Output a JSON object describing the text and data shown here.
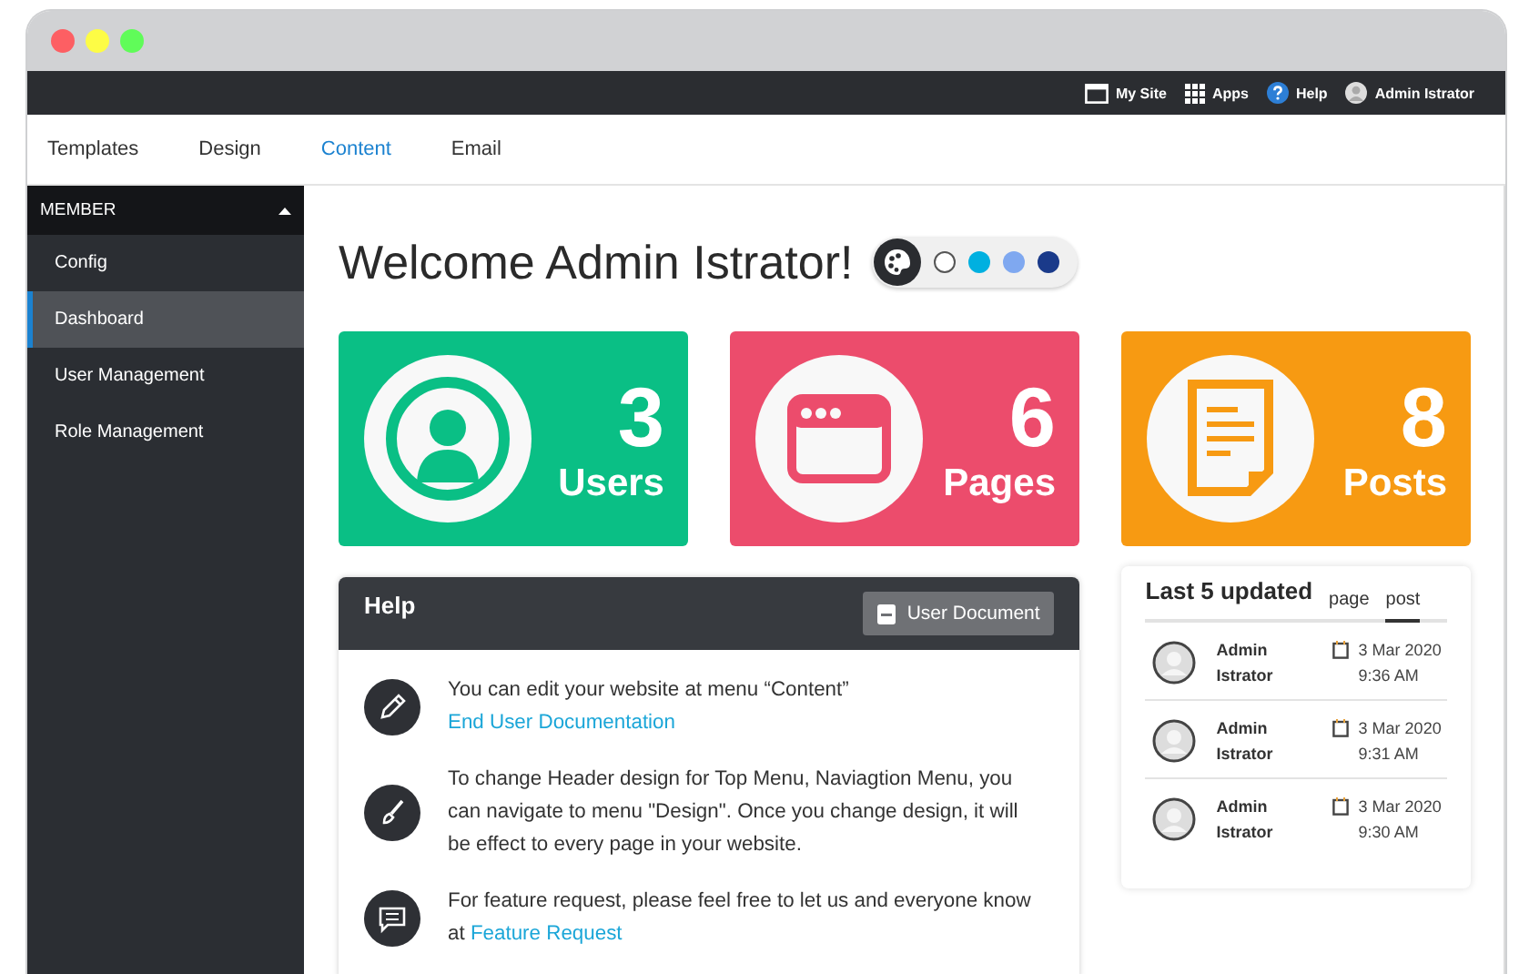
{
  "topbar": {
    "links": [
      {
        "label": "My Site",
        "kind": "site"
      },
      {
        "label": "Apps",
        "kind": "apps"
      },
      {
        "label": "Help",
        "kind": "help"
      },
      {
        "label": "Admin Istrator",
        "kind": "user"
      }
    ]
  },
  "tabs": [
    {
      "label": "Templates",
      "selected": false
    },
    {
      "label": "Design",
      "selected": false
    },
    {
      "label": "Content",
      "selected": true
    },
    {
      "label": "Email",
      "selected": false
    }
  ],
  "sidebar": {
    "header": "MEMBER",
    "expanded": true,
    "items": [
      {
        "label": "Config",
        "selected": false
      },
      {
        "label": "Dashboard",
        "selected": true
      },
      {
        "label": "User Management",
        "selected": false
      },
      {
        "label": "Role Management",
        "selected": false
      }
    ]
  },
  "welcome": "Welcome Admin Istrator!",
  "theme_colors": [
    {
      "color": "#ffffff"
    },
    {
      "color": "#00b0e0"
    },
    {
      "color": "#7fa8f0"
    },
    {
      "color": "#1a3a8a"
    }
  ],
  "stats": [
    {
      "kind": "users",
      "count": "3",
      "label": "Users",
      "color": "#0abf85"
    },
    {
      "kind": "pages",
      "count": "6",
      "label": "Pages",
      "color": "#ec4c6c"
    },
    {
      "kind": "posts",
      "count": "8",
      "label": "Posts",
      "color": "#f79a12"
    }
  ],
  "help": {
    "title": "Help",
    "button": "User Document",
    "items": [
      {
        "kind": "edit",
        "text": "You can edit your website at menu “Content”",
        "link": "End User Documentation"
      },
      {
        "kind": "design",
        "text": "To change Header design for Top Menu, Naviagtion Menu, you can navigate to menu \"Design\". Once you change design, it will be effect to every page in your website."
      },
      {
        "kind": "request",
        "text": "For feature request, please feel free to let us and everyone know at",
        "link": "Feature Request"
      }
    ]
  },
  "updated": {
    "title": "Last 5 updated",
    "tabs": [
      {
        "label": "page",
        "selected": false
      },
      {
        "label": "post",
        "selected": true
      }
    ],
    "rows": [
      {
        "name": "Admin Istrator",
        "date": "3 Mar 2020",
        "time": "9:36 AM"
      },
      {
        "name": "Admin Istrator",
        "date": "3 Mar 2020",
        "time": "9:31 AM"
      },
      {
        "name": "Admin Istrator",
        "date": "3 Mar 2020",
        "time": "9:30 AM"
      }
    ]
  }
}
